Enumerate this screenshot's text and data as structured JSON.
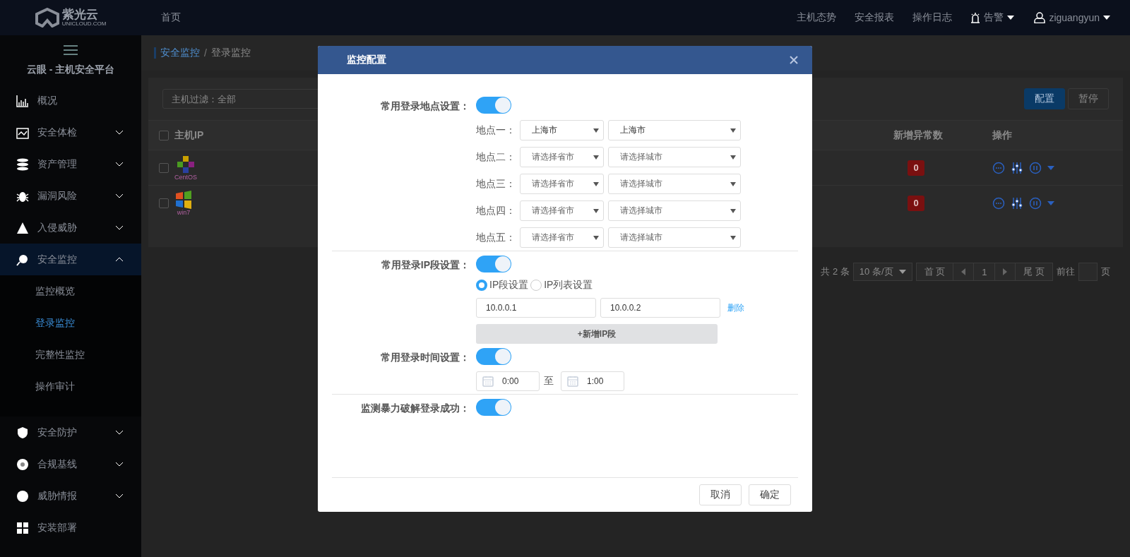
{
  "topbar": {
    "logo_text": "紫光云",
    "logo_subtext": "UNICLOUD.COM",
    "nav": [
      "首页"
    ],
    "right_links": [
      "主机态势",
      "安全报表",
      "操作日志"
    ],
    "alert": "告警",
    "user": "ziguangyun"
  },
  "sidebar": {
    "title": "云眼 - 主机安全平台",
    "items": [
      {
        "label": "概况",
        "selected": false
      },
      {
        "label": "安全体检",
        "selected": false,
        "expanded": false
      },
      {
        "label": "资产管理",
        "selected": false,
        "expanded": false
      },
      {
        "label": "漏洞风险",
        "selected": false,
        "expanded": false
      },
      {
        "label": "入侵威胁",
        "selected": false,
        "expanded": false
      },
      {
        "label": "安全监控",
        "selected": true,
        "expanded": true,
        "children": [
          {
            "label": "监控概览",
            "selected": false
          },
          {
            "label": "登录监控",
            "selected": true
          },
          {
            "label": "完整性监控",
            "selected": false
          },
          {
            "label": "操作审计",
            "selected": false
          }
        ]
      },
      {
        "label": "安全防护",
        "selected": false,
        "expanded": false
      },
      {
        "label": "合规基线",
        "selected": false,
        "expanded": false
      },
      {
        "label": "威胁情报",
        "selected": false,
        "expanded": false
      },
      {
        "label": "安装部署",
        "selected": false
      }
    ]
  },
  "breadcrumb": {
    "items": [
      "安全监控",
      "登录监控"
    ],
    "separator": "/"
  },
  "filter": {
    "value": "主机过滤：全部"
  },
  "toolbar_buttons": [
    {
      "label": "配置",
      "kind": "primary"
    },
    {
      "label": "暂停",
      "kind": "plain"
    }
  ],
  "table": {
    "select_all": {
      "checked": false
    },
    "columns": [
      "主机IP",
      "新增异常数",
      "操作"
    ],
    "rows": [
      {
        "os": "CentOS",
        "checked": false,
        "anomalies": "0"
      },
      {
        "os": "win7",
        "checked": false,
        "anomalies": "0"
      }
    ]
  },
  "pagination": {
    "total": "共 2 条",
    "page_size": "10 条/页",
    "first": "首 页",
    "page": "1",
    "last": "尾 页",
    "goto": "前往",
    "unit": "页"
  },
  "dialog": {
    "title": "监控配置",
    "sections": [
      {
        "kind": "locations",
        "label": "常用登录地点设置：",
        "on": true,
        "locations": [
          {
            "label": "地点一：",
            "province": {
              "value": "上海市"
            },
            "city": {
              "value": "上海市"
            }
          },
          {
            "label": "地点二：",
            "province": {
              "placeholder": "请选择省市"
            },
            "city": {
              "placeholder": "请选择城市"
            }
          },
          {
            "label": "地点三：",
            "province": {
              "placeholder": "请选择省市"
            },
            "city": {
              "placeholder": "请选择城市"
            }
          },
          {
            "label": "地点四：",
            "province": {
              "placeholder": "请选择省市"
            },
            "city": {
              "placeholder": "请选择城市"
            }
          },
          {
            "label": "地点五：",
            "province": {
              "placeholder": "请选择省市"
            },
            "city": {
              "placeholder": "请选择城市"
            }
          }
        ]
      },
      {
        "kind": "ip",
        "label": "常用登录IP段设置：",
        "on": true,
        "modes": [
          {
            "label": "IP段设置",
            "selected": true
          },
          {
            "label": "IP列表设置",
            "selected": false
          }
        ],
        "ranges": [
          {
            "start": "10.0.0.1",
            "end": "10.0.0.2",
            "delete": "删除"
          }
        ],
        "add_button": "+新增IP段"
      },
      {
        "kind": "time",
        "label": "常用登录时间设置：",
        "on": true,
        "start": "0:00",
        "separator": "至",
        "end": "1:00"
      },
      {
        "kind": "toggle",
        "label": "监测暴力破解登录成功：",
        "on": true
      }
    ],
    "buttons": [
      {
        "label": "取消"
      },
      {
        "label": "确定"
      }
    ]
  }
}
